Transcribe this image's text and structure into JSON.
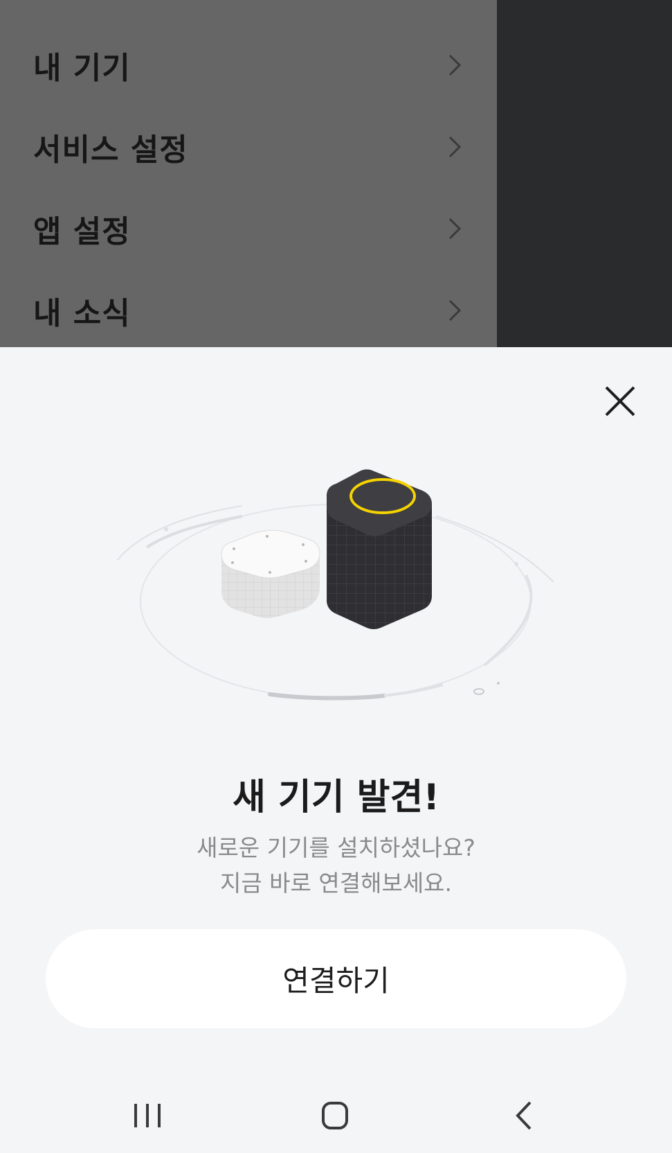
{
  "menu": {
    "items": [
      {
        "label": "내 기기"
      },
      {
        "label": "서비스 설정"
      },
      {
        "label": "앱 설정"
      },
      {
        "label": "내 소식"
      }
    ]
  },
  "sheet": {
    "title": "새 기기 발견!",
    "description_line1": "새로운 기기를 설치하셨나요?",
    "description_line2": "지금 바로 연결해보세요.",
    "connect_label": "연결하기"
  },
  "colors": {
    "accent_ring": "#f5d300",
    "sheet_background": "#f4f5f7",
    "overlay_menu": "#666666"
  },
  "icons": {
    "close": "close-icon",
    "chevron": "chevron-right-icon",
    "nav_recent": "recent-apps-icon",
    "nav_home": "home-icon",
    "nav_back": "back-icon"
  }
}
